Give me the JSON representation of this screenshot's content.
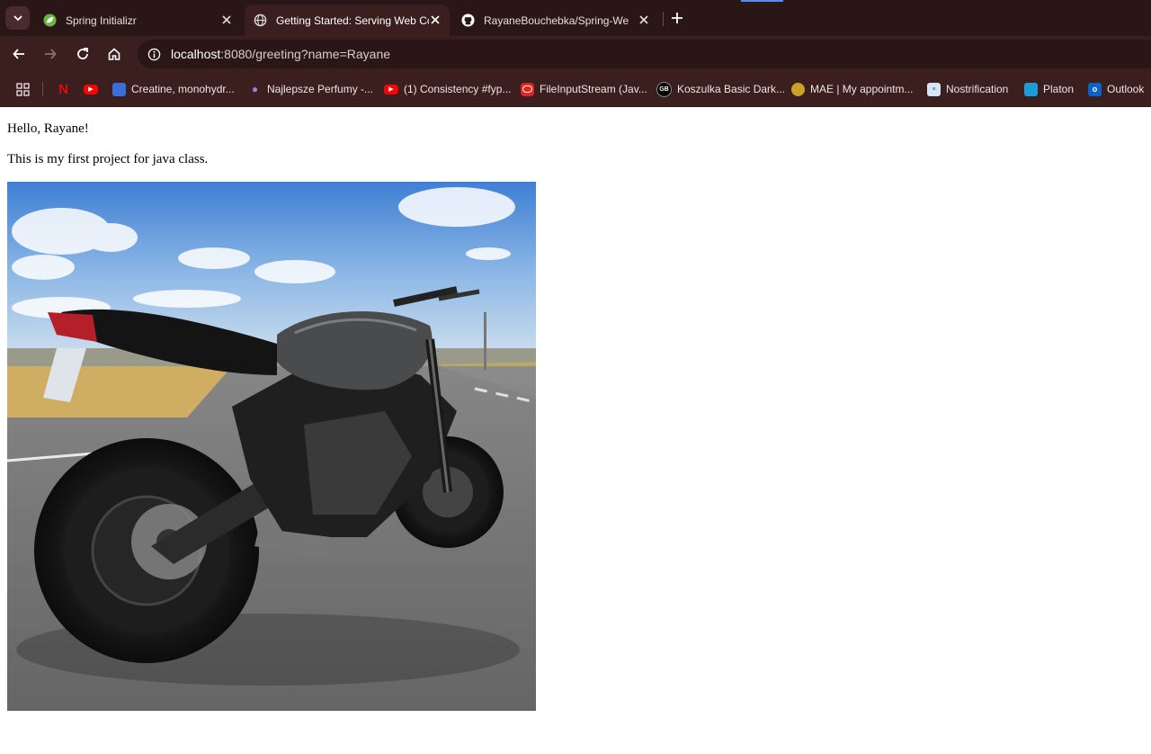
{
  "browser": {
    "tabs": [
      {
        "title": "Spring Initializr",
        "active": false,
        "icon": "spring-leaf-icon"
      },
      {
        "title": "Getting Started: Serving Web Co",
        "active": true,
        "icon": "globe-icon"
      },
      {
        "title": "RayaneBouchebka/Spring-Web",
        "active": false,
        "icon": "github-icon"
      }
    ],
    "url_host": "localhost",
    "url_path": ":8080/greeting?name=Rayane",
    "bookmarks": [
      {
        "label": "",
        "icon": "netflix-icon"
      },
      {
        "label": "",
        "icon": "youtube-icon"
      },
      {
        "label": "Creatine, monohydr...",
        "icon": "shop-icon"
      },
      {
        "label": "Najlepsze Perfumy -...",
        "icon": "perfume-icon"
      },
      {
        "label": "(1) Consistency #fyp...",
        "icon": "youtube-icon"
      },
      {
        "label": "FileInputStream (Jav...",
        "icon": "oracle-icon"
      },
      {
        "label": "Koszulka Basic Dark...",
        "icon": "gb-icon"
      },
      {
        "label": "MAE | My appointm...",
        "icon": "emblem-icon"
      },
      {
        "label": "Nostrification",
        "icon": "nostrification-icon"
      },
      {
        "label": "Platon",
        "icon": "platon-icon"
      },
      {
        "label": "Outlook",
        "icon": "outlook-icon"
      }
    ],
    "colors": {
      "frame": "#2a1616",
      "toolbar": "#3b1e1e",
      "accent": "#5b8de8"
    }
  },
  "page": {
    "greeting": "Hello, Rayane!",
    "description": "This is my first project for java class."
  }
}
